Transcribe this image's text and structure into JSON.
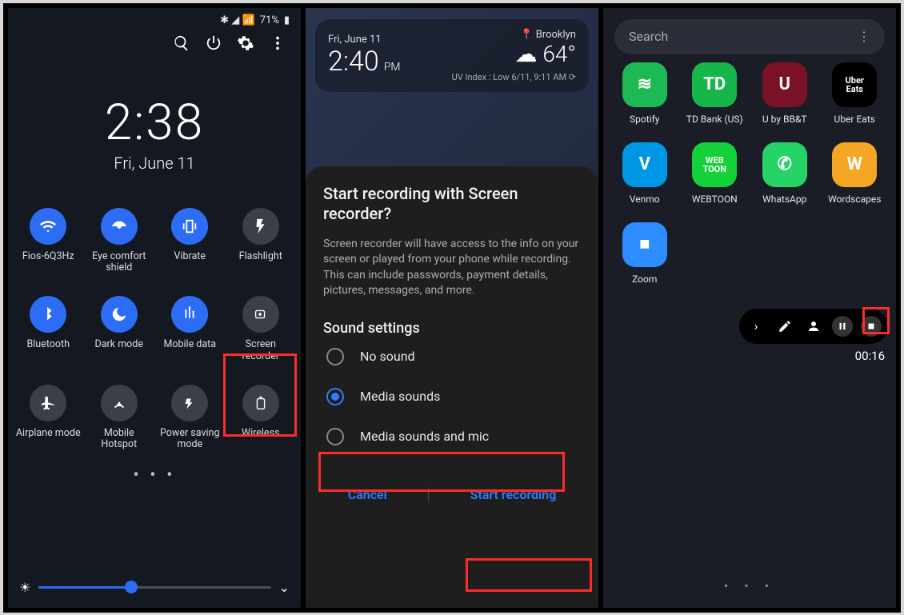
{
  "panel1": {
    "status": {
      "battery": "71%",
      "icons": "✱ 📶"
    },
    "clock": {
      "time": "2:38",
      "date": "Fri, June 11"
    },
    "tiles": [
      {
        "label": "Fios-6Q3Hz",
        "icon": "wifi",
        "on": true
      },
      {
        "label": "Eye comfort shield",
        "icon": "eye",
        "on": true
      },
      {
        "label": "Vibrate",
        "icon": "vibrate",
        "on": true
      },
      {
        "label": "Flashlight",
        "icon": "flash",
        "on": false
      },
      {
        "label": "Bluetooth",
        "icon": "bt",
        "on": true
      },
      {
        "label": "Dark mode",
        "icon": "moon",
        "on": true
      },
      {
        "label": "Mobile data",
        "icon": "data",
        "on": true
      },
      {
        "label": "Screen recorder",
        "icon": "rec",
        "on": false
      },
      {
        "label": "Airplane mode",
        "icon": "plane",
        "on": false
      },
      {
        "label": "Mobile Hotspot",
        "icon": "hotspot",
        "on": false
      },
      {
        "label": "Power saving mode",
        "icon": "power",
        "on": false
      },
      {
        "label": "Wireless",
        "icon": "wireless",
        "on": false
      }
    ]
  },
  "panel2": {
    "weather": {
      "date": "Fri, June 11",
      "time": "2:40",
      "ampm": "PM",
      "loc": "Brooklyn",
      "temp": "64°",
      "sub": "UV Index : Low   6/11, 9:11 AM ⟳"
    },
    "dialog": {
      "title": "Start recording with Screen recorder?",
      "desc": "Screen recorder will have access to the info on your screen or played from your phone while recording. This can include passwords, payment details, pictures, messages, and more.",
      "section": "Sound settings",
      "options": [
        {
          "label": "No sound",
          "selected": false
        },
        {
          "label": "Media sounds",
          "selected": true
        },
        {
          "label": "Media sounds and mic",
          "selected": false
        }
      ],
      "cancel": "Cancel",
      "confirm": "Start recording"
    }
  },
  "panel3": {
    "search_placeholder": "Search",
    "apps": [
      {
        "label": "Spotify",
        "bg": "#1db954",
        "glyph": "≋"
      },
      {
        "label": "TD Bank (US)",
        "bg": "#17b64a",
        "glyph": "TD"
      },
      {
        "label": "U by BB&T",
        "bg": "#7a1127",
        "glyph": "U"
      },
      {
        "label": "Uber Eats",
        "bg": "#000000",
        "glyph": "Uber\nEats"
      },
      {
        "label": "Venmo",
        "bg": "#0096e6",
        "glyph": "V"
      },
      {
        "label": "WEBTOON",
        "bg": "#14d13a",
        "glyph": "WEB\nTOON"
      },
      {
        "label": "WhatsApp",
        "bg": "#25d366",
        "glyph": "✆"
      },
      {
        "label": "Wordscapes",
        "bg": "#f5a623",
        "glyph": "W"
      },
      {
        "label": "Zoom",
        "bg": "#2d8cff",
        "glyph": "■"
      }
    ],
    "rec_time": "00:16"
  }
}
